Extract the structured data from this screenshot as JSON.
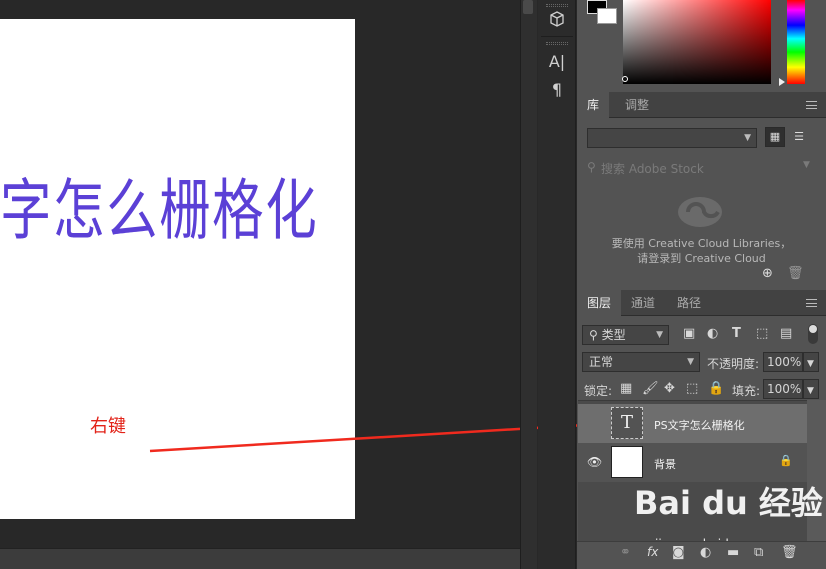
{
  "canvas": {
    "document_text": "字怎么栅格化",
    "annotation": "右键",
    "text_color": "#5b40d6",
    "annotation_color": "#e22319"
  },
  "toolstrip": {
    "icons": [
      "3d-cube-icon",
      "character-icon",
      "paragraph-icon"
    ],
    "character_glyph": "A|",
    "paragraph_glyph": "¶"
  },
  "library_panel": {
    "tabs": [
      "库",
      "调整"
    ],
    "active_tab": "库",
    "search_placeholder": "搜索 Adobe Stock",
    "message_line1": "要使用 Creative Cloud Libraries，",
    "message_line2": "请登录到 Creative Cloud"
  },
  "layers_panel": {
    "tabs": [
      "图层",
      "通道",
      "路径"
    ],
    "active_tab": "图层",
    "filter_label": "类型",
    "blend_mode": "正常",
    "opacity_label": "不透明度:",
    "opacity_value": "100%",
    "lock_label": "锁定:",
    "fill_label": "填充:",
    "fill_value": "100%",
    "layers": [
      {
        "name": "PS文字怎么栅格化",
        "type": "text",
        "selected": true,
        "thumb_glyph": "T"
      },
      {
        "name": "背景",
        "type": "background",
        "selected": false
      }
    ],
    "bottom_fx": "fx"
  },
  "watermark": {
    "brand": "Bai du 经验",
    "url": "jingyan.baidu.com"
  }
}
